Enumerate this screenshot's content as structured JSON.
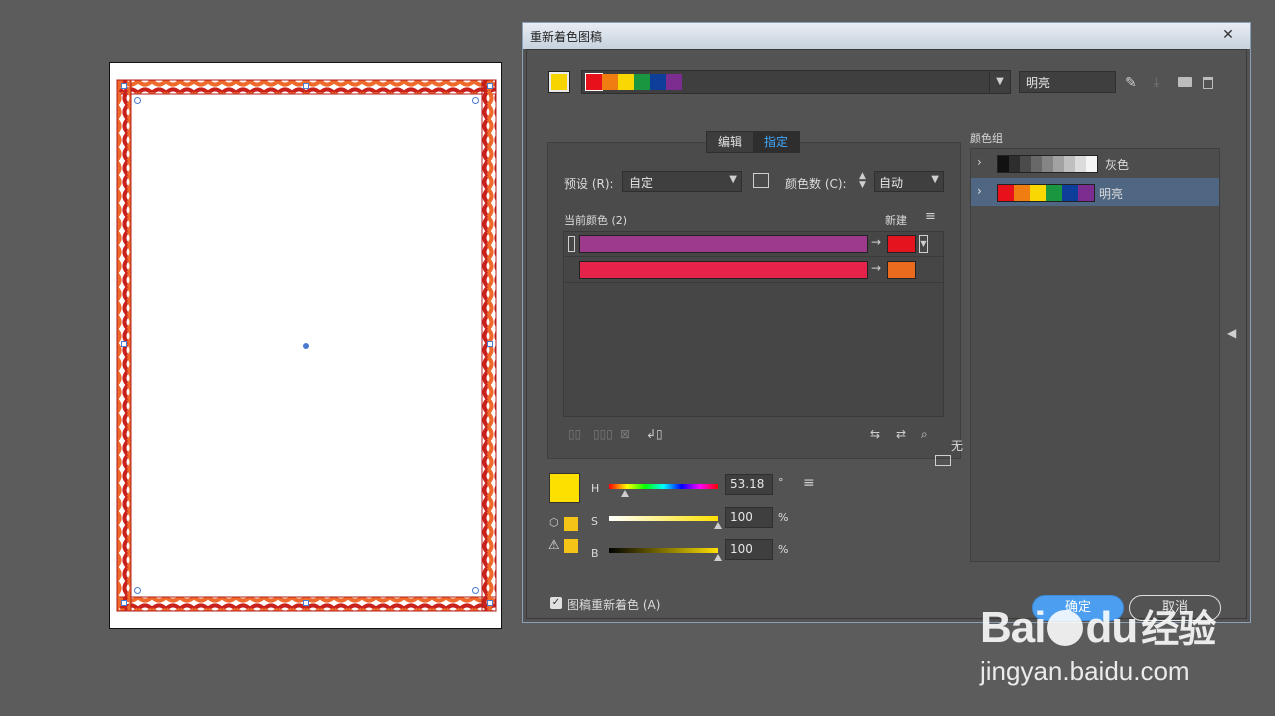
{
  "dialog": {
    "title": "重新着色图稿",
    "close_label": "✕",
    "harmony_name": "明亮",
    "tabs": [
      "编辑",
      "指定"
    ],
    "active_tab": "指定",
    "preset_label": "预设 (R):",
    "preset_value": "自定",
    "colors_count_label": "颜色数 (C):",
    "colors_count_value": "自动",
    "current_colors_label": "当前颜色 (2)",
    "new_label": "新建",
    "none_label": "无",
    "recolor_label": "图稿重新着色 (A)",
    "ok_label": "确定",
    "cancel_label": "取消",
    "harmony_colors": [
      "#e8101b",
      "#ef7d12",
      "#f8d800",
      "#1a9640",
      "#0d3e9a",
      "#7b2e8f"
    ],
    "color_rows": [
      {
        "current": "#9e3a8e",
        "new": "#e3141e"
      },
      {
        "current": "#e4224a",
        "new": "#ea6b1e"
      }
    ],
    "hsb": {
      "h_label": "H",
      "h_value": "53.18",
      "h_unit": "°",
      "s_label": "S",
      "s_value": "100",
      "s_unit": "%",
      "b_label": "B",
      "b_value": "100",
      "b_unit": "%",
      "swatch_color": "#fde000"
    }
  },
  "color_groups": {
    "label": "颜色组",
    "groups": [
      {
        "name": "灰色",
        "colors": [
          "#111111",
          "#2e2e2e",
          "#4b4b4b",
          "#686868",
          "#858585",
          "#a2a2a2",
          "#bfbfbf",
          "#dcdcdc",
          "#f5f5f5"
        ]
      },
      {
        "name": "明亮",
        "colors": [
          "#e8101b",
          "#ef7d12",
          "#f8d800",
          "#1a9640",
          "#0d3e9a",
          "#7b2e8f"
        ]
      }
    ]
  },
  "watermark": {
    "brand": "Bai",
    "brand2": "du",
    "brand_cn": "经验",
    "url": "jingyan.baidu.com"
  }
}
